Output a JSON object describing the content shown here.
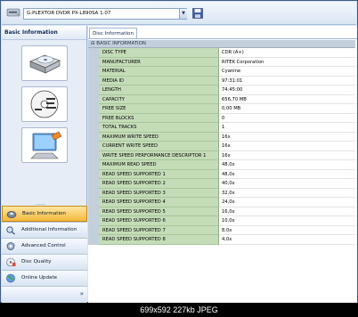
{
  "toolbar": {
    "drive_label": "G:PLEXTOR DVDR   PX-L890SA 1.07",
    "dropdown_glyph": "▼",
    "icons": [
      "drive-icon",
      "save-icon"
    ]
  },
  "left_panel": {
    "title": "Basic Information",
    "features": [
      "disc-drive-icon",
      "disc-label-icon",
      "pc-tools-icon"
    ],
    "grip": "......",
    "nav": [
      {
        "label": "Basic Information",
        "icon": "info-icon",
        "active": true
      },
      {
        "label": "Additional Information",
        "icon": "search-icon",
        "active": false
      },
      {
        "label": "Advanced Control",
        "icon": "gear-icon",
        "active": false
      },
      {
        "label": "Disc Quality",
        "icon": "disc-quality-icon",
        "active": false
      },
      {
        "label": "Online Update",
        "icon": "globe-icon",
        "active": false
      }
    ],
    "more_glyph": "»"
  },
  "tab": {
    "label": "Disc Information"
  },
  "section": {
    "label": "BASIC INFORMATION",
    "toggle": "⊟"
  },
  "rows": [
    {
      "key": "DISC TYPE",
      "value": "CDR (A+)"
    },
    {
      "key": "MANUFACTURER",
      "value": "RITEK Corporation"
    },
    {
      "key": "MATERIAL",
      "value": "Cyanine"
    },
    {
      "key": "MEDIA ID",
      "value": "97:31:01"
    },
    {
      "key": "LENGTH",
      "value": "74:45:00"
    },
    {
      "key": "CAPACITY",
      "value": "656,70 MB"
    },
    {
      "key": "FREE SIZE",
      "value": "0,00 MB"
    },
    {
      "key": "FREE BLOCKS",
      "value": "0"
    },
    {
      "key": "TOTAL TRACKS",
      "value": "1"
    },
    {
      "key": "MAXIMUM WRITE SPEED",
      "value": "16x"
    },
    {
      "key": "CURRENT WRITE SPEED",
      "value": "16x"
    },
    {
      "key": "WRITE SPEED PERFORMANCE DESCRIPTOR 1",
      "value": "16x"
    },
    {
      "key": "MAXIMUM READ SPEED",
      "value": "48,0x"
    },
    {
      "key": "READ SPEED SUPPORTED 1",
      "value": "48,0x"
    },
    {
      "key": "READ SPEED SUPPORTED 2",
      "value": "40,0x"
    },
    {
      "key": "READ SPEED SUPPORTED 3",
      "value": "32,0x"
    },
    {
      "key": "READ SPEED SUPPORTED 4",
      "value": "24,0x"
    },
    {
      "key": "READ SPEED SUPPORTED 5",
      "value": "16,0x"
    },
    {
      "key": "READ SPEED SUPPORTED 6",
      "value": "10,0x"
    },
    {
      "key": "READ SPEED SUPPORTED 7",
      "value": "8,0x"
    },
    {
      "key": "READ SPEED SUPPORTED 8",
      "value": "4,0x"
    }
  ],
  "caption": "699x592  227kb  JPEG"
}
